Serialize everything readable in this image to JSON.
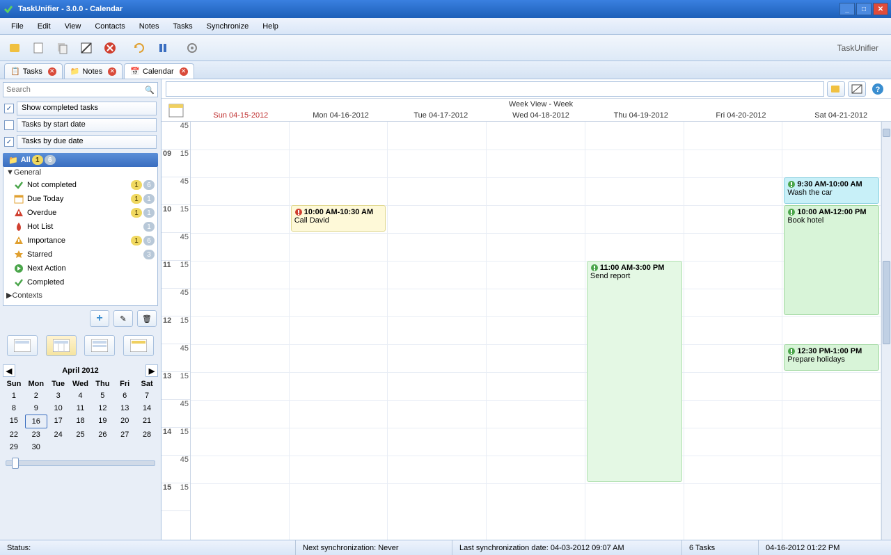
{
  "title": "TaskUnifier - 3.0.0 - Calendar",
  "brand": "TaskUnifier",
  "menu": [
    "File",
    "Edit",
    "View",
    "Contacts",
    "Notes",
    "Tasks",
    "Synchronize",
    "Help"
  ],
  "tabs": [
    {
      "label": "Tasks",
      "active": false
    },
    {
      "label": "Notes",
      "active": false
    },
    {
      "label": "Calendar",
      "active": true
    }
  ],
  "search_placeholder": "Search",
  "filters": [
    {
      "checked": true,
      "label": "Show completed tasks"
    },
    {
      "checked": false,
      "label": "Tasks by start date"
    },
    {
      "checked": true,
      "label": "Tasks by due date"
    }
  ],
  "tree": {
    "all": {
      "label": "All",
      "b1": "1",
      "b2": "6"
    },
    "general": "General",
    "items": [
      {
        "icon": "check",
        "color": "#4aa54a",
        "label": "Not completed",
        "b1": "1",
        "b2": "6"
      },
      {
        "icon": "cal",
        "color": "#e0a030",
        "label": "Due Today",
        "b1": "1",
        "b2": "1"
      },
      {
        "icon": "warn",
        "color": "#d04030",
        "label": "Overdue",
        "b1": "1",
        "b2": "1"
      },
      {
        "icon": "fire",
        "color": "#d04030",
        "label": "Hot List",
        "b1": "",
        "b2": "1"
      },
      {
        "icon": "warn",
        "color": "#e0a030",
        "label": "Importance",
        "b1": "1",
        "b2": "6"
      },
      {
        "icon": "star",
        "color": "#e0a030",
        "label": "Starred",
        "b1": "",
        "b2": "3"
      },
      {
        "icon": "next",
        "color": "#4aa54a",
        "label": "Next Action",
        "b1": "",
        "b2": ""
      },
      {
        "icon": "check",
        "color": "#4aa54a",
        "label": "Completed",
        "b1": "",
        "b2": ""
      }
    ],
    "contexts": "Contexts"
  },
  "minical": {
    "month": "April 2012",
    "dow": [
      "Sun",
      "Mon",
      "Tue",
      "Wed",
      "Thu",
      "Fri",
      "Sat"
    ],
    "days": [
      [
        "1",
        "2",
        "3",
        "4",
        "5",
        "6",
        "7"
      ],
      [
        "8",
        "9",
        "10",
        "11",
        "12",
        "13",
        "14"
      ],
      [
        "15",
        "16",
        "17",
        "18",
        "19",
        "20",
        "21"
      ],
      [
        "22",
        "23",
        "24",
        "25",
        "26",
        "27",
        "28"
      ],
      [
        "29",
        "30",
        "",
        "",
        "",
        "",
        ""
      ]
    ],
    "today": "16"
  },
  "calendar": {
    "view_title": "Week View - Week",
    "days": [
      "Sun 04-15-2012",
      "Mon 04-16-2012",
      "Tue 04-17-2012",
      "Wed 04-18-2012",
      "Thu 04-19-2012",
      "Fri 04-20-2012",
      "Sat 04-21-2012"
    ],
    "hours": [
      "09",
      "10",
      "11",
      "12",
      "13",
      "14",
      "15"
    ],
    "events": [
      {
        "day": 1,
        "start": 10,
        "end": 10.5,
        "time": "10:00 AM-10:30 AM",
        "title": "Call David",
        "cls": "yellow",
        "icon": "red"
      },
      {
        "day": 4,
        "start": 11,
        "end": 15,
        "time": "11:00 AM-3:00 PM",
        "title": "Send report",
        "cls": "lgreen",
        "icon": "green"
      },
      {
        "day": 6,
        "start": 9.5,
        "end": 10,
        "time": "9:30 AM-10:00 AM",
        "title": "Wash the car",
        "cls": "cyan",
        "icon": "green"
      },
      {
        "day": 6,
        "start": 10,
        "end": 12,
        "time": "10:00 AM-12:00 PM",
        "title": "Book hotel",
        "cls": "green",
        "icon": "green"
      },
      {
        "day": 6,
        "start": 12.5,
        "end": 13,
        "time": "12:30 PM-1:00 PM",
        "title": "Prepare holidays",
        "cls": "green",
        "icon": "green"
      }
    ]
  },
  "status": {
    "s1": "Status:",
    "s2": "Next synchronization: Never",
    "s3": "Last synchronization date: 04-03-2012 09:07 AM",
    "s4": "6 Tasks",
    "s5": "04-16-2012 01:22 PM"
  }
}
